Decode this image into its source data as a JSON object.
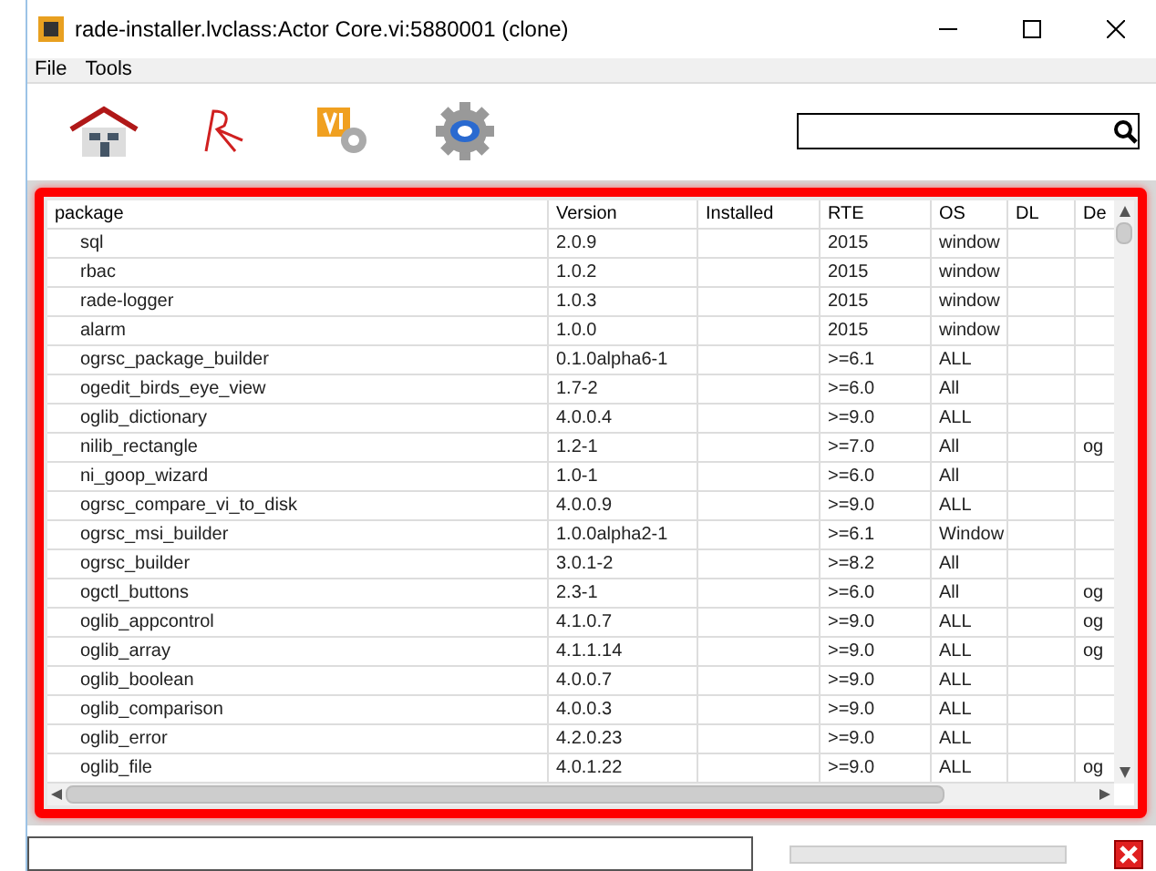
{
  "window": {
    "title": "rade-installer.lvclass:Actor Core.vi:5880001 (clone)"
  },
  "menu": [
    "File",
    "Tools"
  ],
  "table": {
    "columns": [
      "package",
      "Version",
      "Installed",
      "RTE",
      "OS",
      "DL",
      "De"
    ],
    "rows": [
      [
        "sql",
        "2.0.9",
        "",
        "2015",
        "window",
        "",
        ""
      ],
      [
        "rbac",
        "1.0.2",
        "",
        "2015",
        "window",
        "",
        ""
      ],
      [
        "rade-logger",
        "1.0.3",
        "",
        "2015",
        "window",
        "",
        ""
      ],
      [
        "alarm",
        "1.0.0",
        "",
        "2015",
        "window",
        "",
        ""
      ],
      [
        "ogrsc_package_builder",
        "0.1.0alpha6-1",
        "",
        ">=6.1",
        "ALL",
        "",
        ""
      ],
      [
        "ogedit_birds_eye_view",
        "1.7-2",
        "",
        ">=6.0",
        "All",
        "",
        ""
      ],
      [
        "oglib_dictionary",
        "4.0.0.4",
        "",
        ">=9.0",
        "ALL",
        "",
        ""
      ],
      [
        "nilib_rectangle",
        "1.2-1",
        "",
        ">=7.0",
        "All",
        "",
        "og"
      ],
      [
        "ni_goop_wizard",
        "1.0-1",
        "",
        ">=6.0",
        "All",
        "",
        ""
      ],
      [
        "ogrsc_compare_vi_to_disk",
        "4.0.0.9",
        "",
        ">=9.0",
        "ALL",
        "",
        ""
      ],
      [
        "ogrsc_msi_builder",
        "1.0.0alpha2-1",
        "",
        ">=6.1",
        "Window",
        "",
        ""
      ],
      [
        "ogrsc_builder",
        "3.0.1-2",
        "",
        ">=8.2",
        "All",
        "",
        ""
      ],
      [
        "ogctl_buttons",
        "2.3-1",
        "",
        ">=6.0",
        "All",
        "",
        "og"
      ],
      [
        "oglib_appcontrol",
        "4.1.0.7",
        "",
        ">=9.0",
        "ALL",
        "",
        "og"
      ],
      [
        "oglib_array",
        "4.1.1.14",
        "",
        ">=9.0",
        "ALL",
        "",
        "og"
      ],
      [
        "oglib_boolean",
        "4.0.0.7",
        "",
        ">=9.0",
        "ALL",
        "",
        ""
      ],
      [
        "oglib_comparison",
        "4.0.0.3",
        "",
        ">=9.0",
        "ALL",
        "",
        ""
      ],
      [
        "oglib_error",
        "4.2.0.23",
        "",
        ">=9.0",
        "ALL",
        "",
        ""
      ],
      [
        "oglib_file",
        "4.0.1.22",
        "",
        ">=9.0",
        "ALL",
        "",
        "og"
      ]
    ]
  },
  "progress": {
    "level": 0
  }
}
